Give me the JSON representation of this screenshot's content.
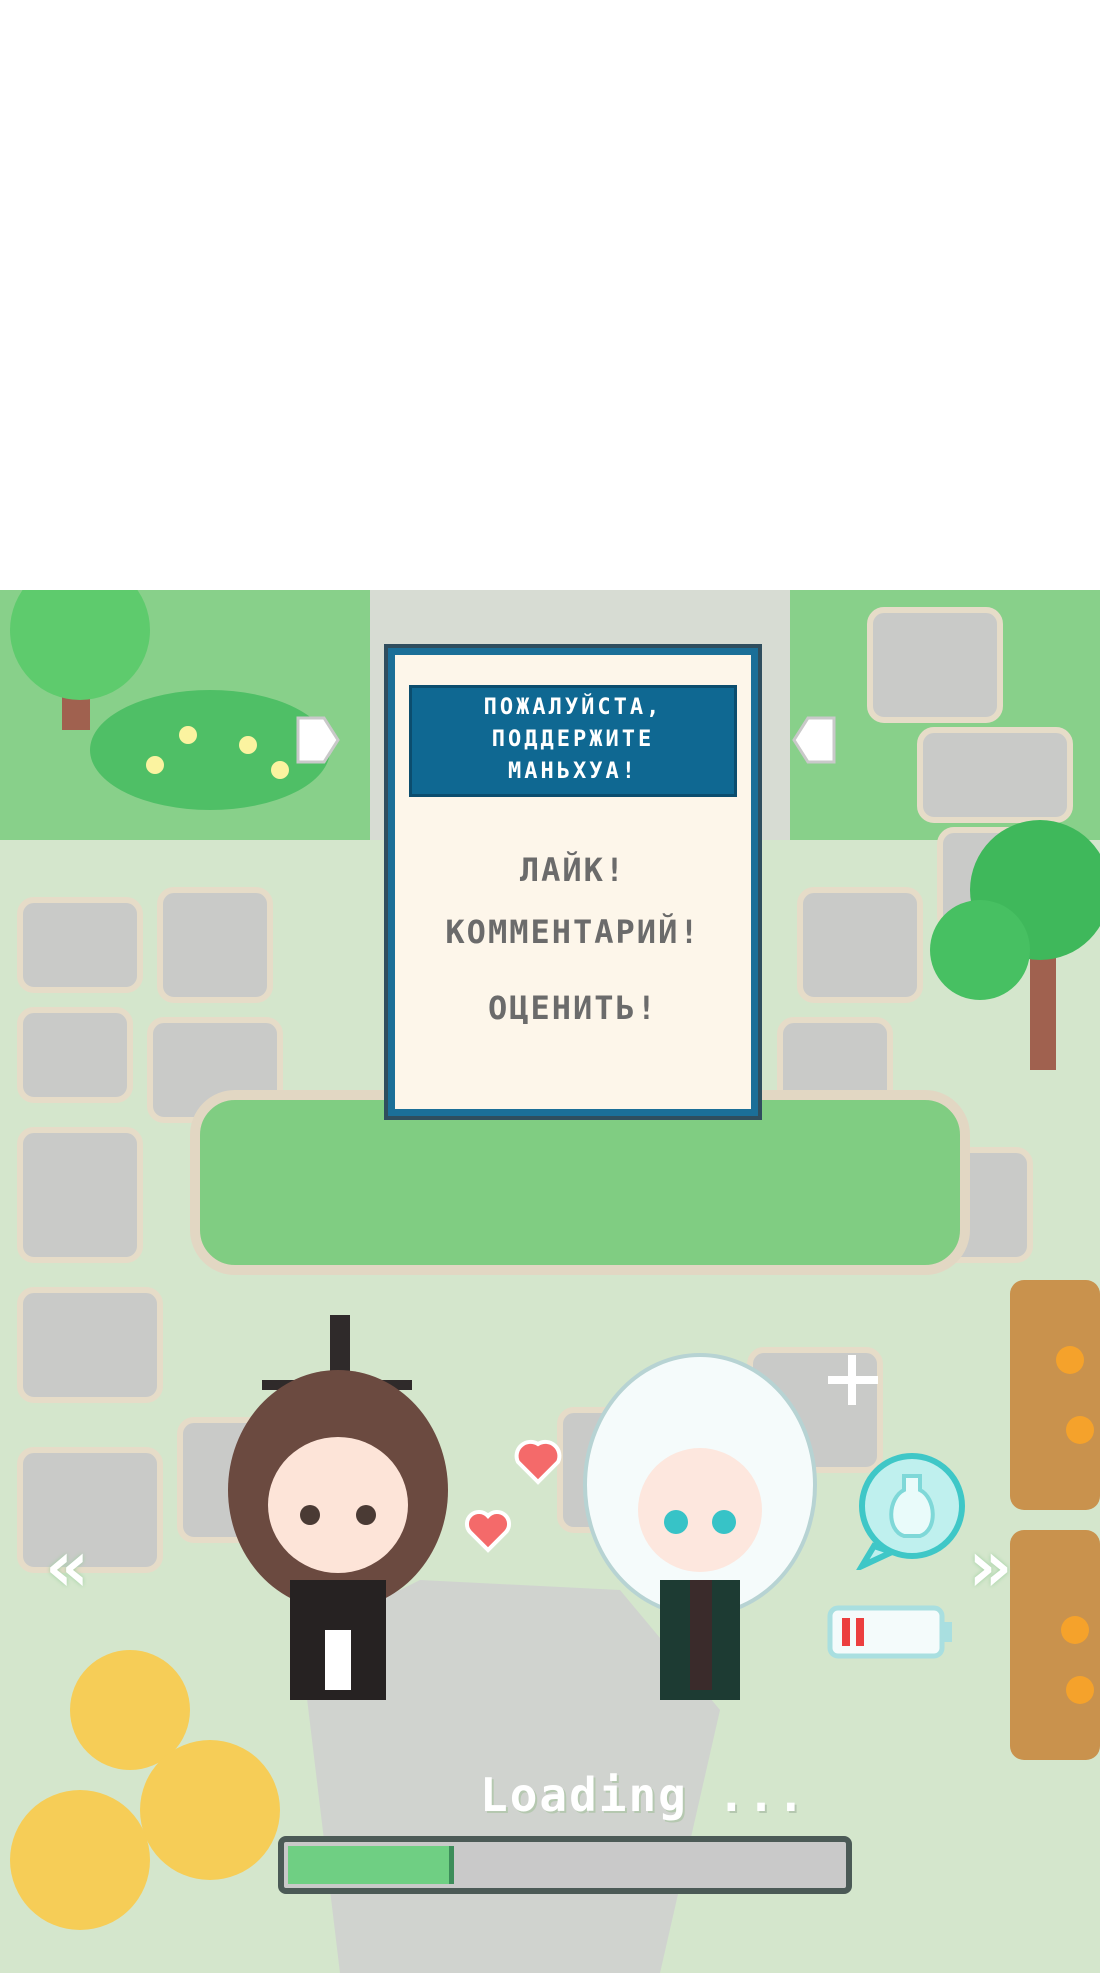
{
  "dialog": {
    "header": "ПОЖАЛУЙСТА,\nПОДДЕРЖИТЕ\nМАНЬХУА!",
    "items": [
      "ЛАЙК!",
      "КОММЕНТАРИЙ!",
      "ОЦЕНИТЬ!"
    ]
  },
  "loading": {
    "label": "Loading ...",
    "progress": 0.29
  },
  "nav": {
    "prev_icon": "«",
    "next_icon": "»"
  },
  "colors": {
    "dialog_border": "#1b6f98",
    "dialog_header": "#0f6892",
    "progress_fill": "#6fcf83",
    "grass": "#7dc97f",
    "stone": "#cfd0cf"
  }
}
